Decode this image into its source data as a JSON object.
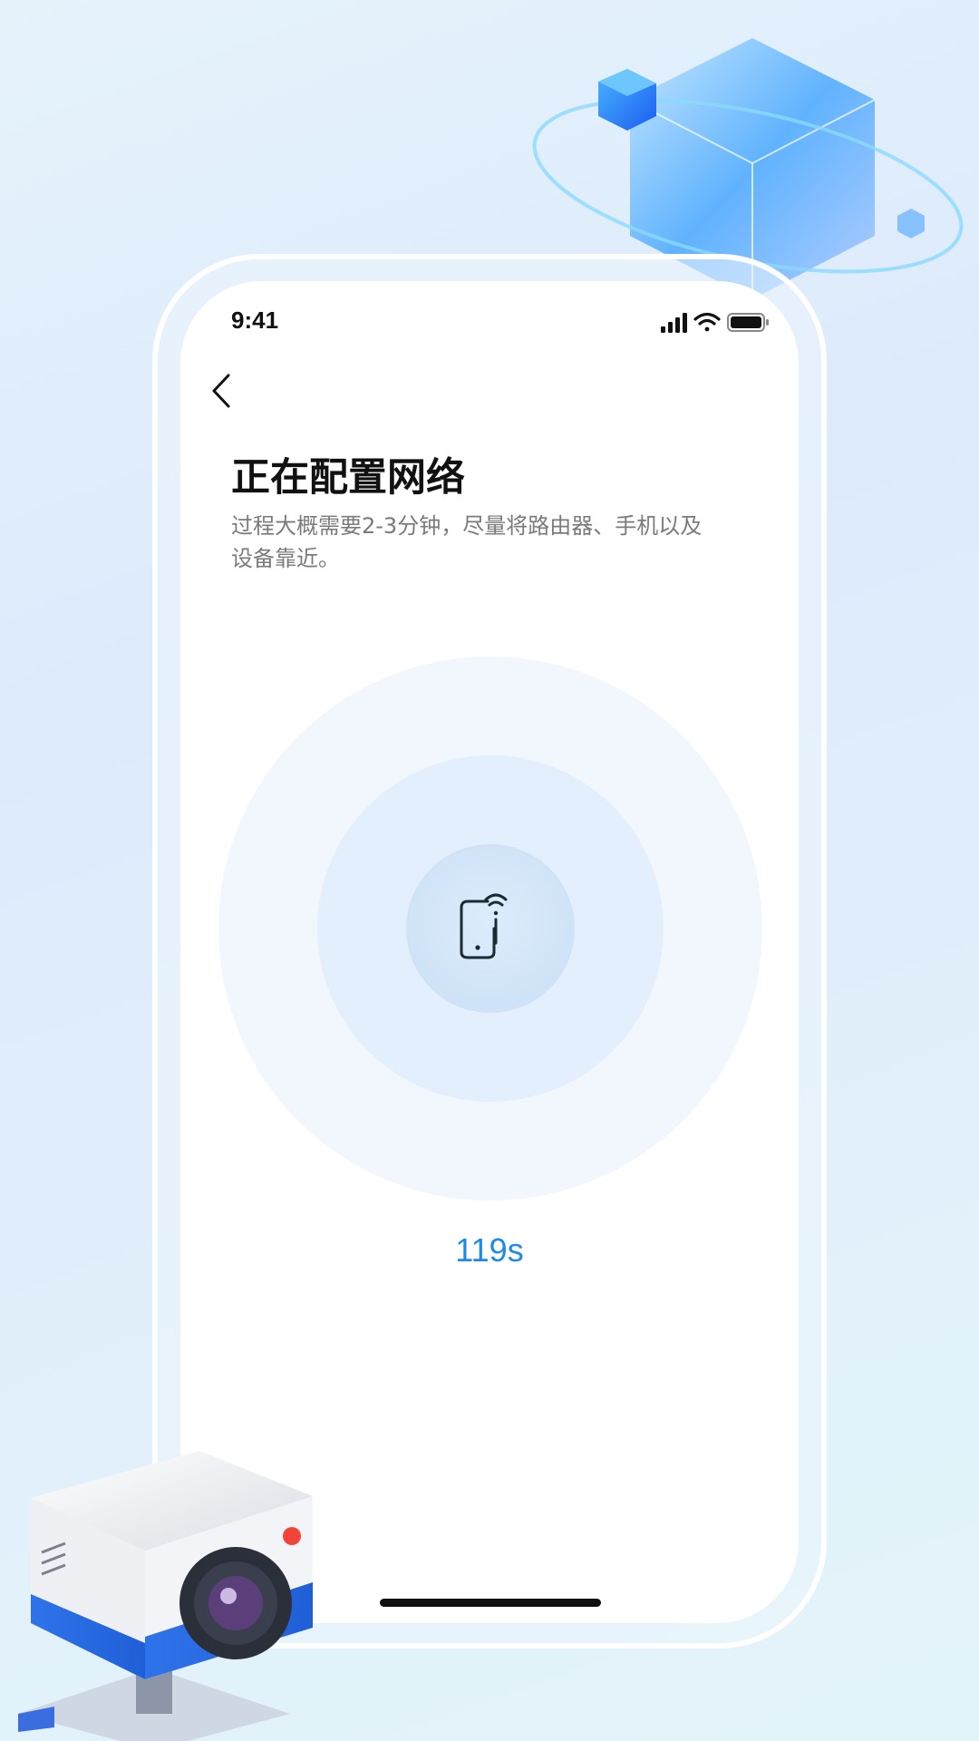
{
  "status_bar": {
    "time": "9:41"
  },
  "page": {
    "title": "正在配置网络",
    "subtitle": "过程大概需要2-3分钟，尽量将路由器、手机以及设备靠近。",
    "countdown": "119s"
  },
  "icons": {
    "back": "chevron-left-icon",
    "center": "phone-wifi-icon",
    "status": [
      "signal-icon",
      "wifi-icon",
      "battery-icon"
    ]
  },
  "colors": {
    "accent": "#1d8ae9",
    "title": "#111111",
    "subtitle": "#7a7a7a"
  }
}
